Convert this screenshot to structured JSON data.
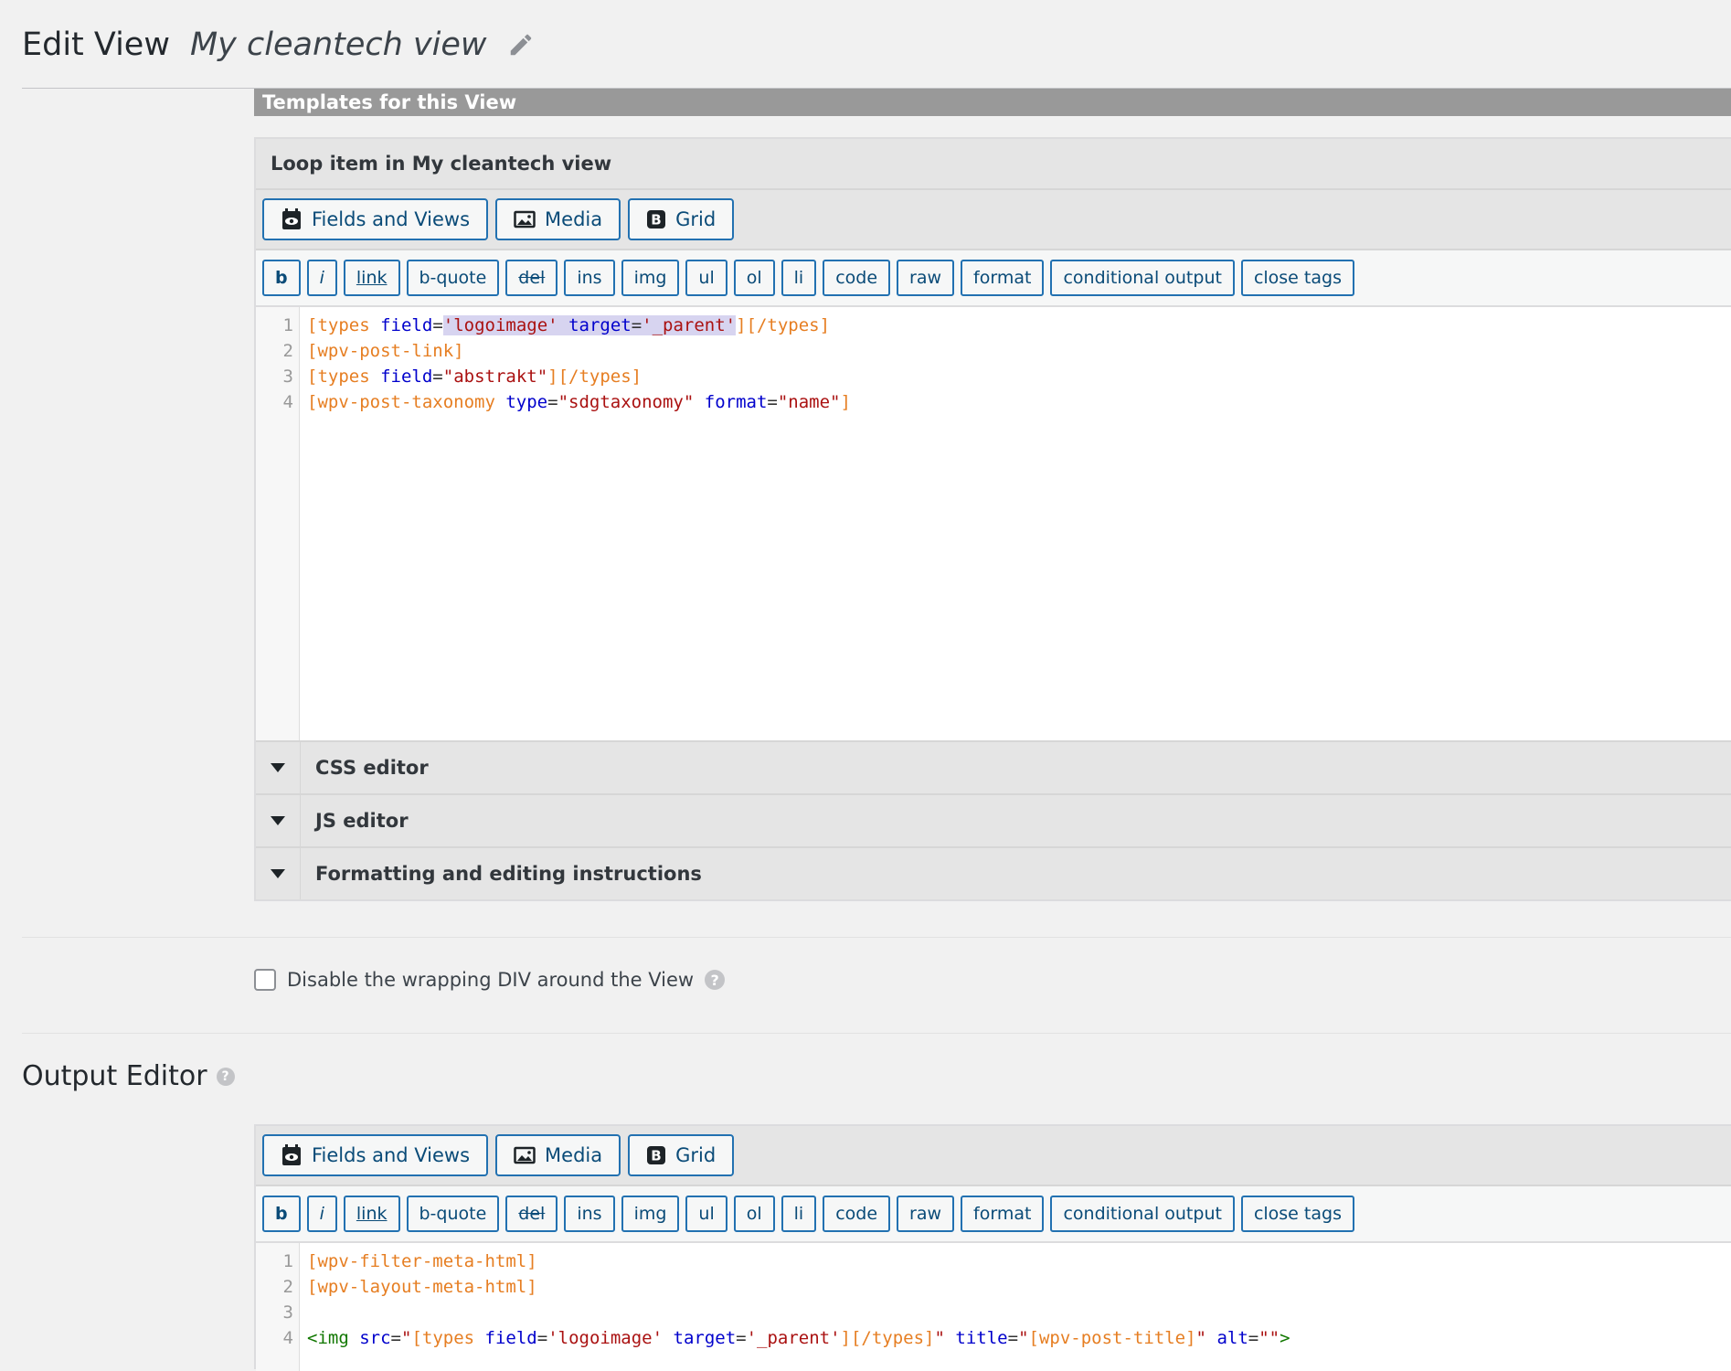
{
  "header": {
    "title": "Edit View",
    "view_name": "My cleantech view"
  },
  "templates_section": {
    "title": "Templates for this View",
    "loop_item_title": "Loop item in My cleantech view"
  },
  "toolbar_big": {
    "fields_views": "Fields and Views",
    "media": "Media",
    "grid": "Grid"
  },
  "quicktags": [
    "b",
    "i",
    "link",
    "b-quote",
    "del",
    "ins",
    "img",
    "ul",
    "ol",
    "li",
    "code",
    "raw",
    "format",
    "conditional output",
    "close tags"
  ],
  "loop_editor": {
    "line_numbers": [
      "1",
      "2",
      "3",
      "4"
    ],
    "lines": [
      [
        [
          "br",
          "["
        ],
        [
          "br",
          "types"
        ],
        [
          "pl",
          " "
        ],
        [
          "at",
          "field"
        ],
        [
          "pl",
          "="
        ],
        [
          "st",
          "'logoimage'"
        ],
        [
          "pl",
          " "
        ],
        [
          "at",
          "target"
        ],
        [
          "pl",
          "="
        ],
        [
          "st",
          "'_parent'"
        ],
        [
          "br",
          "][/types]"
        ]
      ],
      [
        [
          "br",
          "[wpv-post-link]"
        ]
      ],
      [
        [
          "br",
          "[types"
        ],
        [
          "pl",
          " "
        ],
        [
          "at",
          "field"
        ],
        [
          "pl",
          "="
        ],
        [
          "st",
          "\"abstrakt\""
        ],
        [
          "br",
          "][/types]"
        ]
      ],
      [
        [
          "br",
          "[wpv-post-taxonomy"
        ],
        [
          "pl",
          " "
        ],
        [
          "at",
          "type"
        ],
        [
          "pl",
          "="
        ],
        [
          "st",
          "\"sdgtaxonomy\""
        ],
        [
          "pl",
          " "
        ],
        [
          "at",
          "format"
        ],
        [
          "pl",
          "="
        ],
        [
          "st",
          "\"name\""
        ],
        [
          "br",
          "]"
        ]
      ]
    ]
  },
  "collapsibles": {
    "css": "CSS editor",
    "js": "JS editor",
    "instructions": "Formatting and editing instructions"
  },
  "wrap_div_label": "Disable the wrapping DIV around the View",
  "output_editor": {
    "title": "Output Editor",
    "line_numbers": [
      "1",
      "2",
      "3",
      "4"
    ],
    "lines": [
      [
        [
          "br",
          "[wpv-filter-meta-html]"
        ]
      ],
      [
        [
          "br",
          "[wpv-layout-meta-html]"
        ]
      ],
      [],
      [
        [
          "tg",
          "<img"
        ],
        [
          "pl",
          " "
        ],
        [
          "at",
          "src"
        ],
        [
          "pl",
          "="
        ],
        [
          "st",
          "\""
        ],
        [
          "br",
          "[types"
        ],
        [
          "pl",
          " "
        ],
        [
          "at",
          "field"
        ],
        [
          "pl",
          "="
        ],
        [
          "st",
          "'logoimage'"
        ],
        [
          "pl",
          " "
        ],
        [
          "at",
          "target"
        ],
        [
          "pl",
          "="
        ],
        [
          "st",
          "'_parent'"
        ],
        [
          "br",
          "][/types]"
        ],
        [
          "st",
          "\""
        ],
        [
          "pl",
          " "
        ],
        [
          "at",
          "title"
        ],
        [
          "pl",
          "="
        ],
        [
          "st",
          "\""
        ],
        [
          "br",
          "[wpv-post-title]"
        ],
        [
          "st",
          "\""
        ],
        [
          "pl",
          " "
        ],
        [
          "at",
          "alt"
        ],
        [
          "pl",
          "="
        ],
        [
          "st",
          "\"\""
        ],
        [
          "tg",
          ">"
        ]
      ]
    ]
  },
  "colors": {
    "accent": "#2271b1",
    "section_band": "#999999",
    "shortcode": "#e67e22",
    "attribute": "#0000cc",
    "string": "#aa1111",
    "tag": "#117700",
    "selection": "#d7d4f0"
  },
  "icons": {
    "edit_title": "pencil-icon",
    "fields_views": "camera-eye-icon",
    "media": "image-icon",
    "grid": "bootstrap-b-icon",
    "collapse": "triangle-down-icon",
    "help": "question-circle-icon"
  }
}
